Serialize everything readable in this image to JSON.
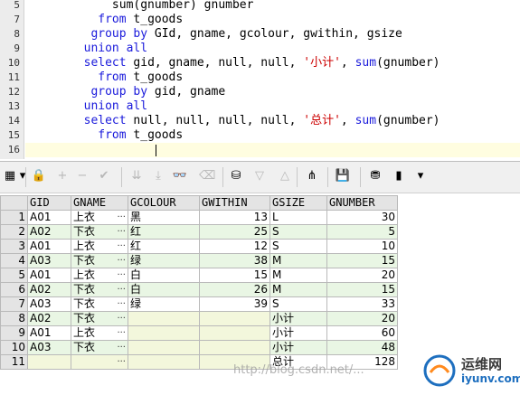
{
  "editor": {
    "lines": [
      {
        "num": "5",
        "tokens": [
          {
            "t": "            sum(gnumber) gnumber",
            "c": "tx"
          }
        ]
      },
      {
        "num": "7",
        "tokens": [
          {
            "t": "          ",
            "c": "tx"
          },
          {
            "t": "from",
            "c": "kw"
          },
          {
            "t": " t_goods",
            "c": "tx"
          }
        ]
      },
      {
        "num": "8",
        "tokens": [
          {
            "t": "         ",
            "c": "tx"
          },
          {
            "t": "group by",
            "c": "kw"
          },
          {
            "t": " GId, gname, gcolour, gwithin, gsize",
            "c": "tx"
          }
        ]
      },
      {
        "num": "9",
        "tokens": [
          {
            "t": "        ",
            "c": "tx"
          },
          {
            "t": "union all",
            "c": "kw"
          }
        ]
      },
      {
        "num": "10",
        "tokens": [
          {
            "t": "        ",
            "c": "tx"
          },
          {
            "t": "select",
            "c": "kw"
          },
          {
            "t": " gid, gname, null, null, ",
            "c": "tx"
          },
          {
            "t": "'小计'",
            "c": "st"
          },
          {
            "t": ", ",
            "c": "tx"
          },
          {
            "t": "sum",
            "c": "kw"
          },
          {
            "t": "(gnumber)",
            "c": "tx"
          }
        ]
      },
      {
        "num": "11",
        "tokens": [
          {
            "t": "          ",
            "c": "tx"
          },
          {
            "t": "from",
            "c": "kw"
          },
          {
            "t": " t_goods",
            "c": "tx"
          }
        ]
      },
      {
        "num": "12",
        "tokens": [
          {
            "t": "         ",
            "c": "tx"
          },
          {
            "t": "group by",
            "c": "kw"
          },
          {
            "t": " gid, gname",
            "c": "tx"
          }
        ]
      },
      {
        "num": "13",
        "tokens": [
          {
            "t": "        ",
            "c": "tx"
          },
          {
            "t": "union all",
            "c": "kw"
          }
        ]
      },
      {
        "num": "14",
        "tokens": [
          {
            "t": "        ",
            "c": "tx"
          },
          {
            "t": "select",
            "c": "kw"
          },
          {
            "t": " null, null, null, null, ",
            "c": "tx"
          },
          {
            "t": "'总计'",
            "c": "st"
          },
          {
            "t": ", ",
            "c": "tx"
          },
          {
            "t": "sum",
            "c": "kw"
          },
          {
            "t": "(gnumber)",
            "c": "tx"
          }
        ]
      },
      {
        "num": "15",
        "tokens": [
          {
            "t": "          ",
            "c": "tx"
          },
          {
            "t": "from",
            "c": "kw"
          },
          {
            "t": " t_goods",
            "c": "tx"
          }
        ]
      },
      {
        "num": "16",
        "tokens": []
      }
    ]
  },
  "toolbar": {
    "icons": [
      {
        "name": "grid-menu-icon",
        "glyph": "▦",
        "dis": false
      },
      {
        "name": "dropdown-arrow-icon",
        "glyph": "▾",
        "dis": false
      },
      {
        "name": "lock-icon",
        "glyph": "🔒",
        "dis": false
      },
      {
        "name": "add-record-icon",
        "glyph": "+",
        "dis": true
      },
      {
        "name": "delete-record-icon",
        "glyph": "−",
        "dis": true
      },
      {
        "name": "post-changes-icon",
        "glyph": "✔",
        "dis": true
      },
      {
        "name": "fetch-next-icon",
        "glyph": "⇊",
        "dis": true
      },
      {
        "name": "fetch-last-icon",
        "glyph": "⤓",
        "dis": true
      },
      {
        "name": "find-binoculars-icon",
        "glyph": "👓",
        "dis": false
      },
      {
        "name": "clear-icon",
        "glyph": "⌫",
        "dis": true
      },
      {
        "name": "query-by-example-icon",
        "glyph": "⛁",
        "dis": false
      },
      {
        "name": "previous-icon",
        "glyph": "▽",
        "dis": true
      },
      {
        "name": "next-icon",
        "glyph": "△",
        "dis": true
      },
      {
        "name": "tree-view-icon",
        "glyph": "⋔",
        "dis": false
      },
      {
        "name": "save-icon",
        "glyph": "💾",
        "dis": false
      },
      {
        "name": "export-icon",
        "glyph": "⛃",
        "dis": false
      },
      {
        "name": "chart-icon",
        "glyph": "▮",
        "dis": false
      },
      {
        "name": "dropdown-arrow-icon",
        "glyph": "▾",
        "dis": false
      }
    ]
  },
  "grid": {
    "columns": [
      "GID",
      "GNAME",
      "GCOLOUR",
      "GWITHIN",
      "GSIZE",
      "GNUMBER"
    ],
    "rows": [
      [
        "1",
        "A01",
        "上衣",
        "黑",
        "13",
        "L",
        "30"
      ],
      [
        "2",
        "A02",
        "下衣",
        "红",
        "25",
        "S",
        "5"
      ],
      [
        "3",
        "A01",
        "上衣",
        "红",
        "12",
        "S",
        "10"
      ],
      [
        "4",
        "A03",
        "下衣",
        "绿",
        "38",
        "M",
        "15"
      ],
      [
        "5",
        "A01",
        "上衣",
        "白",
        "15",
        "M",
        "20"
      ],
      [
        "6",
        "A02",
        "下衣",
        "白",
        "26",
        "M",
        "15"
      ],
      [
        "7",
        "A03",
        "下衣",
        "绿",
        "39",
        "S",
        "33"
      ],
      [
        "8",
        "A02",
        "下衣",
        "",
        "",
        "小计",
        "20"
      ],
      [
        "9",
        "A01",
        "上衣",
        "",
        "",
        "小计",
        "60"
      ],
      [
        "10",
        "A03",
        "下衣",
        "",
        "",
        "小计",
        "48"
      ],
      [
        "11",
        "",
        "",
        "",
        "",
        "总计",
        "128"
      ]
    ]
  },
  "watermark": {
    "url": "http://blog.csdn.net/...",
    "logo_title": "运维网",
    "logo_sub": "iyunv.com"
  }
}
